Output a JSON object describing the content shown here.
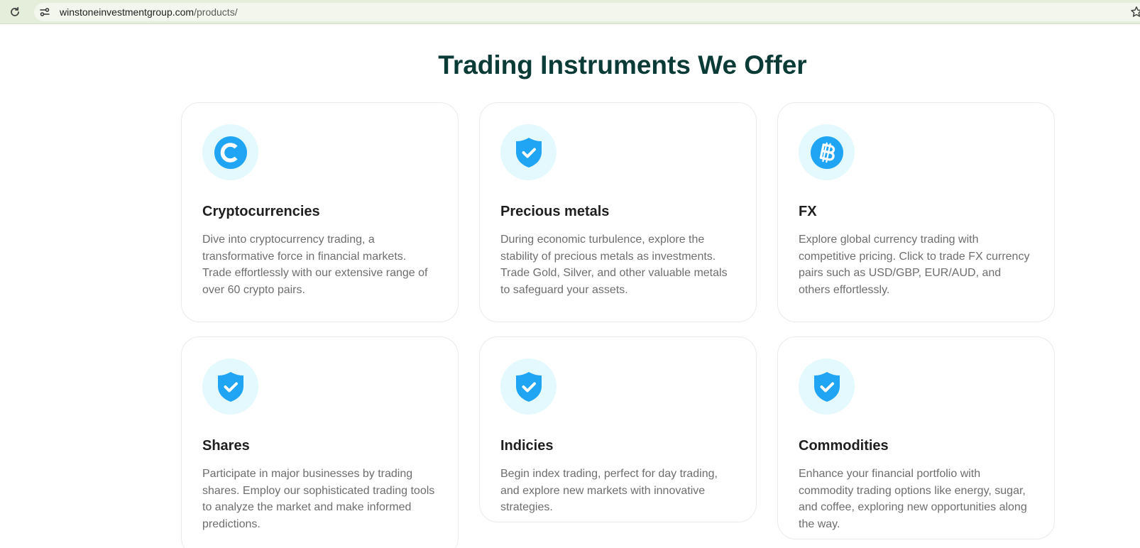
{
  "browser": {
    "url_domain": "winstoneinvestmentgroup.com",
    "url_path": "/products/"
  },
  "page": {
    "title": "Trading Instruments We Offer"
  },
  "cards": [
    {
      "icon": "copyright-c-icon",
      "title": "Cryptocurrencies",
      "description": "Dive into cryptocurrency trading, a transformative force in financial markets. Trade effortlessly with our extensive range of over 60 crypto pairs."
    },
    {
      "icon": "shield-check-icon",
      "title": "Precious metals",
      "description": "During economic turbulence, explore the stability of precious metals as investments. Trade Gold, Silver, and other valuable metals to safeguard your assets."
    },
    {
      "icon": "bitcoin-icon",
      "title": "FX",
      "description": "Explore global currency trading with competitive pricing. Click to trade FX currency pairs such as USD/GBP, EUR/AUD, and others effortlessly."
    },
    {
      "icon": "shield-check-icon",
      "title": "Shares",
      "description": "Participate in major businesses by trading shares. Employ our sophisticated trading tools to analyze the market and make informed predictions."
    },
    {
      "icon": "shield-check-icon",
      "title": "Indicies",
      "description": "Begin index trading, perfect for day trading, and explore new markets with innovative strategies."
    },
    {
      "icon": "shield-check-icon",
      "title": "Commodities",
      "description": "Enhance your financial portfolio with commodity trading options like energy, sugar, and coffee, exploring new opportunities along the way."
    }
  ],
  "colors": {
    "accent_blue": "#1fa5f4",
    "icon_bg": "#e4f9fd",
    "title_green": "#0b3b36"
  }
}
